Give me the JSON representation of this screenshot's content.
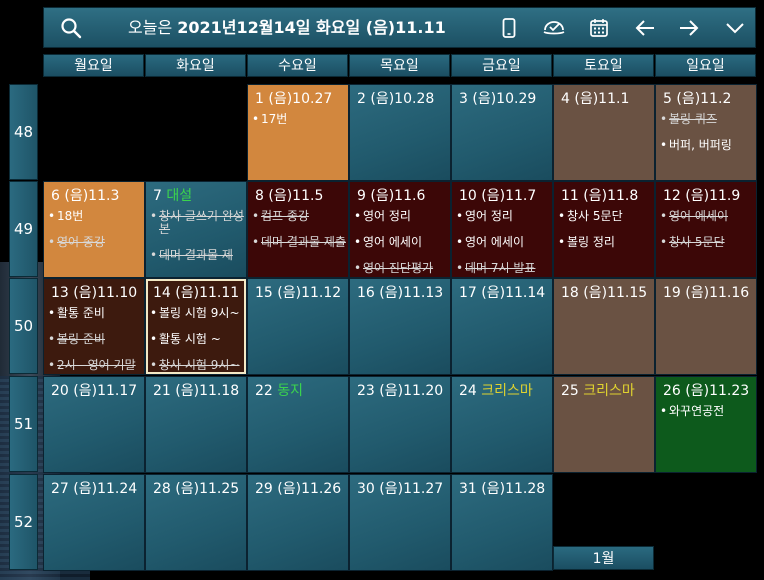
{
  "header": {
    "title_prefix": "오늘은 ",
    "title_date": "2021년12월14일 화요일",
    "title_lunar": " (음)11.11"
  },
  "days_of_week": [
    "월요일",
    "화요일",
    "수요일",
    "목요일",
    "금요일",
    "토요일",
    "일요일"
  ],
  "weeks": [
    {
      "label": "48",
      "cells": [
        null,
        null,
        {
          "day": "1",
          "lunar": "(음)10.27",
          "style": "orange",
          "events": [
            {
              "t": "17번",
              "done": false
            }
          ]
        },
        {
          "day": "2",
          "lunar": "(음)10.28",
          "style": "norm",
          "events": []
        },
        {
          "day": "3",
          "lunar": "(음)10.29",
          "style": "norm",
          "events": []
        },
        {
          "day": "4",
          "lunar": "(음)11.1",
          "style": "sat",
          "events": []
        },
        {
          "day": "5",
          "lunar": "(음)11.2",
          "style": "sat",
          "events": [
            {
              "t": "볼링 퀴즈",
              "done": true
            },
            {
              "t": "버퍼, 버퍼링",
              "done": false
            }
          ]
        }
      ]
    },
    {
      "label": "49",
      "cells": [
        {
          "day": "6",
          "lunar": "(음)11.3",
          "style": "orange",
          "events": [
            {
              "t": "18번",
              "done": false
            },
            {
              "t": "영어 종강",
              "done": true
            }
          ]
        },
        {
          "day": "7",
          "lunar": "",
          "special": "대설",
          "specialColor": "green",
          "style": "norm",
          "events": [
            {
              "t": "창사 글쓰기 완성본",
              "done": true
            },
            {
              "t": "데머 결과물 제",
              "done": true
            }
          ]
        },
        {
          "day": "8",
          "lunar": "(음)11.5",
          "style": "weekend-red",
          "events": [
            {
              "t": "컴프 종강",
              "done": true
            },
            {
              "t": "데머 결과물 제출",
              "done": true
            }
          ]
        },
        {
          "day": "9",
          "lunar": "(음)11.6",
          "style": "weekend-red",
          "events": [
            {
              "t": "영어 정리",
              "done": false
            },
            {
              "t": "영어 에세이",
              "done": false
            },
            {
              "t": "영어 진단평가",
              "done": true
            }
          ]
        },
        {
          "day": "10",
          "lunar": "(음)11.7",
          "style": "weekend-red",
          "events": [
            {
              "t": "영어 정리",
              "done": false
            },
            {
              "t": "영어 에세이",
              "done": false
            },
            {
              "t": "데머 7시 발표",
              "done": true
            }
          ]
        },
        {
          "day": "11",
          "lunar": "(음)11.8",
          "style": "weekend-red",
          "events": [
            {
              "t": "창사 5문단",
              "done": false
            },
            {
              "t": "볼링 정리",
              "done": false
            }
          ]
        },
        {
          "day": "12",
          "lunar": "(음)11.9",
          "style": "weekend-red",
          "events": [
            {
              "t": "영어 에세이",
              "done": true
            },
            {
              "t": "창사 5문단",
              "done": true
            }
          ]
        }
      ]
    },
    {
      "label": "50",
      "cells": [
        {
          "day": "13",
          "lunar": "(음)11.10",
          "style": "dark",
          "events": [
            {
              "t": "활통 준비",
              "done": false
            },
            {
              "t": "볼링 준비",
              "done": true
            },
            {
              "t": "2시 - 영어 기말",
              "done": true
            }
          ]
        },
        {
          "day": "14",
          "lunar": "(음)11.11",
          "style": "today",
          "events": [
            {
              "t": "볼링 시험 9시~",
              "done": false
            },
            {
              "t": "활통 시험 ~",
              "done": false
            },
            {
              "t": "창사 시험 9시~",
              "done": true
            }
          ]
        },
        {
          "day": "15",
          "lunar": "(음)11.12",
          "style": "norm",
          "events": []
        },
        {
          "day": "16",
          "lunar": "(음)11.13",
          "style": "norm",
          "events": []
        },
        {
          "day": "17",
          "lunar": "(음)11.14",
          "style": "norm",
          "events": []
        },
        {
          "day": "18",
          "lunar": "(음)11.15",
          "style": "sat",
          "events": []
        },
        {
          "day": "19",
          "lunar": "(음)11.16",
          "style": "sat",
          "events": []
        }
      ]
    },
    {
      "label": "51",
      "cells": [
        {
          "day": "20",
          "lunar": "(음)11.17",
          "style": "norm",
          "events": []
        },
        {
          "day": "21",
          "lunar": "(음)11.18",
          "style": "norm",
          "events": []
        },
        {
          "day": "22",
          "lunar": "",
          "special": "동지",
          "specialColor": "green",
          "style": "norm",
          "events": []
        },
        {
          "day": "23",
          "lunar": "(음)11.20",
          "style": "norm",
          "events": []
        },
        {
          "day": "24",
          "lunar": "",
          "special": "크리스마",
          "specialColor": "yellow",
          "style": "norm",
          "events": []
        },
        {
          "day": "25",
          "lunar": "",
          "special": "크리스마",
          "specialColor": "yellow",
          "style": "sat",
          "events": []
        },
        {
          "day": "26",
          "lunar": "(음)11.23",
          "style": "holiday",
          "events": [
            {
              "t": "와꾸연공전",
              "done": false
            }
          ]
        }
      ]
    },
    {
      "label": "52",
      "cells": [
        {
          "day": "27",
          "lunar": "(음)11.24",
          "style": "norm",
          "events": []
        },
        {
          "day": "28",
          "lunar": "(음)11.25",
          "style": "norm",
          "events": []
        },
        {
          "day": "29",
          "lunar": "(음)11.26",
          "style": "norm",
          "events": []
        },
        {
          "day": "30",
          "lunar": "(음)11.27",
          "style": "norm",
          "events": []
        },
        {
          "day": "31",
          "lunar": "(음)11.28",
          "style": "norm",
          "events": []
        },
        null,
        null
      ]
    }
  ],
  "next_month_label": "1월",
  "icons": [
    "search-icon",
    "phone-icon",
    "check-badge-icon",
    "calendar-icon",
    "arrow-left-icon",
    "arrow-right-icon",
    "chevron-down-icon"
  ]
}
